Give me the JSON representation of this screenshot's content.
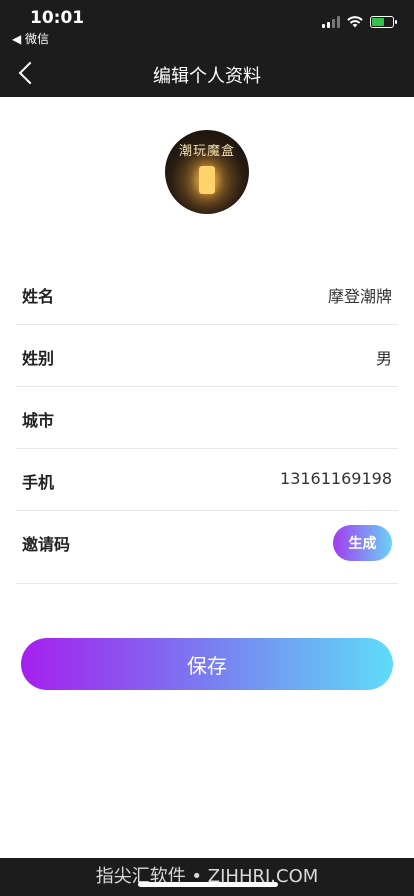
{
  "status_bar": {
    "time": "10:01",
    "back_app": "◀ 微信",
    "battery_color": "#36c24a"
  },
  "nav": {
    "title": "编辑个人资料",
    "back_icon": "chevron-left-icon"
  },
  "avatar": {
    "logo_text": "潮玩魔盒"
  },
  "form": {
    "rows": [
      {
        "label": "姓名",
        "value": "摩登潮牌"
      },
      {
        "label": "姓别",
        "value": "男"
      },
      {
        "label": "城市",
        "value": ""
      },
      {
        "label": "手机",
        "value": "13161169198"
      },
      {
        "label": "邀请码",
        "value": ""
      }
    ],
    "generate_label": "生成"
  },
  "save_label": "保存",
  "watermark": "指尖汇软件 • ZJHHRJ.COM",
  "colors": {
    "gradient_start": "#a51fef",
    "gradient_end": "#5fdcf8",
    "header_bg": "#1c1c1c"
  }
}
